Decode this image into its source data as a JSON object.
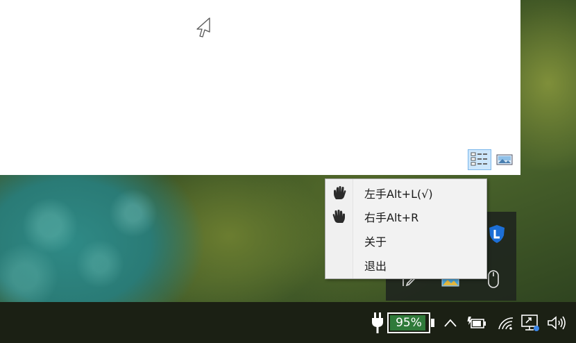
{
  "context_menu": {
    "items": [
      {
        "label": "左手Alt+L(√)",
        "icon": "left-hand-icon"
      },
      {
        "label": "右手Alt+R",
        "icon": "right-hand-icon"
      },
      {
        "label": "关于",
        "icon": ""
      },
      {
        "label": "退出",
        "icon": ""
      }
    ]
  },
  "app_window": {
    "view_buttons": [
      {
        "name": "details-view-icon",
        "active": true
      },
      {
        "name": "picture-view-icon",
        "active": false
      }
    ]
  },
  "tray_overflow_icons": [
    "shield-app-icon",
    "pen-icon",
    "photo-app-icon",
    "mouse-icon"
  ],
  "taskbar": {
    "battery_percent_label": "95%",
    "battery_level": 0.95,
    "icons": [
      "power-plug-icon",
      "show-hidden-icons-chevron",
      "battery-saver-icon",
      "wifi-icon",
      "remote-display-icon",
      "volume-icon"
    ]
  },
  "colors": {
    "battery_fill": "#2f7a3a",
    "menu_background": "#f2f2f2",
    "taskbar": "#1b2014",
    "selected_view": "#cce6fb"
  }
}
